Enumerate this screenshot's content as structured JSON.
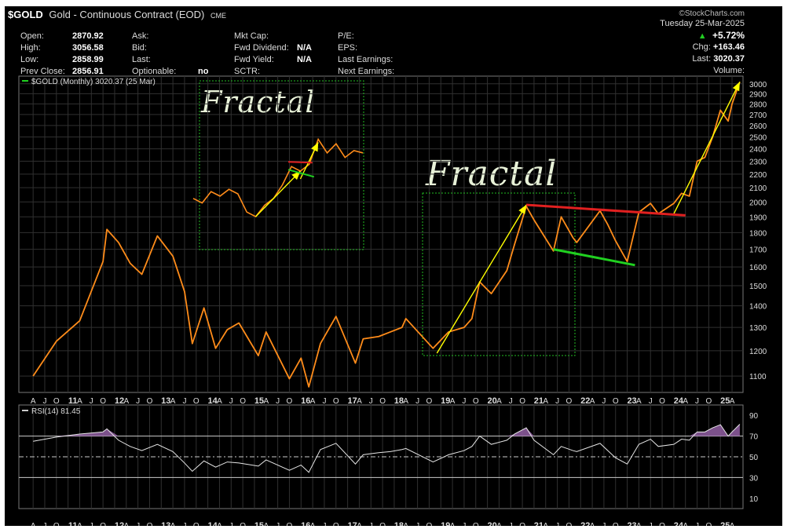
{
  "header": {
    "symbol": "$GOLD",
    "name": "Gold - Continuous Contract (EOD)",
    "exchange": "CME",
    "watermark": "©StockCharts.com",
    "date": "Tuesday  25-Mar-2025",
    "change_pct": "+5.72%",
    "chg_label": "Chg:",
    "chg_value": "+163.46",
    "last_label": "Last:",
    "last_value": "3020.37",
    "volume_label": "Volume:"
  },
  "quote": {
    "col1": [
      {
        "label": "Open:",
        "value": "2870.92"
      },
      {
        "label": "High:",
        "value": "3056.58"
      },
      {
        "label": "Low:",
        "value": "2858.99"
      },
      {
        "label": "Prev Close:",
        "value": "2856.91"
      }
    ],
    "col2": [
      {
        "label": "Ask:",
        "value": ""
      },
      {
        "label": "Bid:",
        "value": ""
      },
      {
        "label": "Last:",
        "value": ""
      },
      {
        "label": "Optionable:",
        "value": "no"
      }
    ],
    "col3": [
      {
        "label": "Mkt Cap:",
        "value": ""
      },
      {
        "label": "Fwd Dividend:",
        "value": "N/A"
      },
      {
        "label": "Fwd Yield:",
        "value": "N/A"
      },
      {
        "label": "SCTR:",
        "value": ""
      }
    ],
    "col4": [
      {
        "label": "P/E:"
      },
      {
        "label": "EPS:"
      },
      {
        "label": "Last Earnings:"
      },
      {
        "label": "Next Earnings:"
      }
    ]
  },
  "annotations": {
    "fractal_small": "Fractal",
    "fractal_large": "Fractal"
  },
  "colors": {
    "price_line": "#ff8c1a",
    "arrow": "#ffff00",
    "resistance": "#e02020",
    "support": "#20d020",
    "box": "#22bb22",
    "rsi_fill": "#8a5a9a",
    "up_green": "#22cc22"
  },
  "chart_data": [
    {
      "type": "line",
      "legend": "$GOLD (Monthly) 3020.37 (25 Mar)",
      "scale": "log",
      "ylim": [
        1040,
        3080
      ],
      "y_ticks": [
        1100,
        1200,
        1300,
        1400,
        1500,
        1600,
        1700,
        1800,
        1900,
        2000,
        2100,
        2200,
        2300,
        2400,
        2500,
        2600,
        2700,
        2800,
        2900,
        3000
      ],
      "x_ticks": [
        "A",
        "J",
        "O",
        "11",
        "A",
        "J",
        "O",
        "12",
        "A",
        "J",
        "O",
        "13",
        "A",
        "J",
        "O",
        "14",
        "A",
        "J",
        "O",
        "15",
        "A",
        "J",
        "O",
        "16",
        "A",
        "J",
        "O",
        "17",
        "A",
        "J",
        "O",
        "18",
        "A",
        "J",
        "O",
        "19",
        "A",
        "J",
        "O",
        "20",
        "A",
        "J",
        "O",
        "21",
        "A",
        "J",
        "O",
        "22",
        "A",
        "J",
        "O",
        "23",
        "A",
        "J",
        "O",
        "24",
        "A",
        "J",
        "O",
        "25",
        "A"
      ],
      "x": [
        "2010-01",
        "2010-07",
        "2011-01",
        "2011-07",
        "2011-08",
        "2011-11",
        "2012-02",
        "2012-05",
        "2012-09",
        "2013-01",
        "2013-04",
        "2013-06",
        "2013-09",
        "2013-12",
        "2014-03",
        "2014-06",
        "2014-11",
        "2015-01",
        "2015-07",
        "2015-10",
        "2015-12",
        "2016-03",
        "2016-07",
        "2016-12",
        "2017-02",
        "2017-06",
        "2017-09",
        "2017-12",
        "2018-01",
        "2018-08",
        "2018-12",
        "2019-04",
        "2019-06",
        "2019-08",
        "2019-11",
        "2020-03",
        "2020-05",
        "2020-08",
        "2020-10",
        "2021-03",
        "2021-05",
        "2021-08",
        "2021-09",
        "2022-03",
        "2022-05",
        "2022-07",
        "2022-10",
        "2023-01",
        "2023-04",
        "2023-06",
        "2023-10",
        "2023-12",
        "2024-02",
        "2024-04",
        "2024-06",
        "2024-08",
        "2024-10",
        "2024-12",
        "2025-01",
        "2025-03"
      ],
      "values": [
        1100,
        1240,
        1330,
        1630,
        1820,
        1740,
        1620,
        1560,
        1780,
        1660,
        1470,
        1230,
        1390,
        1210,
        1290,
        1320,
        1180,
        1280,
        1090,
        1170,
        1060,
        1230,
        1350,
        1150,
        1250,
        1260,
        1280,
        1300,
        1340,
        1210,
        1280,
        1300,
        1340,
        1520,
        1460,
        1580,
        1730,
        1970,
        1880,
        1690,
        1900,
        1770,
        1740,
        1940,
        1850,
        1750,
        1630,
        1930,
        1990,
        1920,
        1990,
        2060,
        2040,
        2300,
        2330,
        2500,
        2740,
        2640,
        2800,
        3020
      ],
      "overlay_lines": [
        {
          "name": "arrow_2018",
          "from": [
            "2018-09",
            1190
          ],
          "to": [
            "2020-08",
            1980
          ]
        },
        {
          "name": "arrow_2023",
          "from": [
            "2023-10",
            1920
          ],
          "to": [
            "2025-03",
            3020
          ]
        },
        {
          "name": "resistance",
          "from": [
            "2020-08",
            1980
          ],
          "to": [
            "2024-01",
            1910
          ]
        },
        {
          "name": "support",
          "from": [
            "2021-03",
            1700
          ],
          "to": [
            "2022-12",
            1610
          ]
        }
      ]
    },
    {
      "type": "line",
      "legend": "RSI(14) 81.45",
      "ylim": [
        0,
        100
      ],
      "y_ticks": [
        10,
        30,
        50,
        70,
        90
      ],
      "reference_lines": [
        30,
        50,
        70
      ],
      "x": [
        "2010-01",
        "2010-07",
        "2011-01",
        "2011-07",
        "2011-08",
        "2011-11",
        "2012-02",
        "2012-05",
        "2012-09",
        "2013-01",
        "2013-04",
        "2013-06",
        "2013-09",
        "2013-12",
        "2014-03",
        "2014-06",
        "2014-11",
        "2015-01",
        "2015-07",
        "2015-10",
        "2015-12",
        "2016-03",
        "2016-07",
        "2016-12",
        "2017-02",
        "2017-06",
        "2017-09",
        "2017-12",
        "2018-01",
        "2018-08",
        "2018-12",
        "2019-04",
        "2019-06",
        "2019-08",
        "2019-11",
        "2020-03",
        "2020-05",
        "2020-08",
        "2020-10",
        "2021-03",
        "2021-05",
        "2021-08",
        "2021-09",
        "2022-03",
        "2022-05",
        "2022-07",
        "2022-10",
        "2023-01",
        "2023-04",
        "2023-06",
        "2023-10",
        "2023-12",
        "2024-02",
        "2024-04",
        "2024-06",
        "2024-08",
        "2024-10",
        "2024-12",
        "2025-01",
        "2025-03"
      ],
      "values": [
        65,
        69,
        72,
        74,
        77,
        66,
        60,
        56,
        62,
        55,
        44,
        36,
        46,
        40,
        45,
        44,
        41,
        47,
        37,
        42,
        35,
        57,
        63,
        43,
        52,
        54,
        55,
        57,
        58,
        45,
        52,
        56,
        60,
        70,
        62,
        66,
        72,
        78,
        66,
        52,
        60,
        56,
        55,
        63,
        56,
        49,
        43,
        62,
        67,
        60,
        62,
        67,
        66,
        74,
        74,
        78,
        81,
        70,
        74,
        81.45
      ],
      "x_ticks": [
        "A",
        "J",
        "O",
        "11",
        "A",
        "J",
        "O",
        "12",
        "A",
        "J",
        "O",
        "13",
        "A",
        "J",
        "O",
        "14",
        "A",
        "J",
        "O",
        "15",
        "A",
        "J",
        "O",
        "16",
        "A",
        "J",
        "O",
        "17",
        "A",
        "J",
        "O",
        "18",
        "A",
        "J",
        "O",
        "19",
        "A",
        "J",
        "O",
        "20",
        "A",
        "J",
        "O",
        "21",
        "A",
        "J",
        "O",
        "22",
        "A",
        "J",
        "O",
        "23",
        "A",
        "J",
        "O",
        "24",
        "A",
        "J",
        "O",
        "25",
        "A"
      ]
    },
    {
      "type": "line",
      "name": "inset_fractal",
      "values": [
        1,
        0.9,
        1.15,
        1.05,
        1.2,
        1.1,
        0.7,
        0.6,
        0.85,
        1.0,
        1.3,
        1.7,
        1.6,
        1.75,
        2.3,
        2.0,
        2.2,
        1.9,
        2.05,
        2.0
      ]
    }
  ]
}
